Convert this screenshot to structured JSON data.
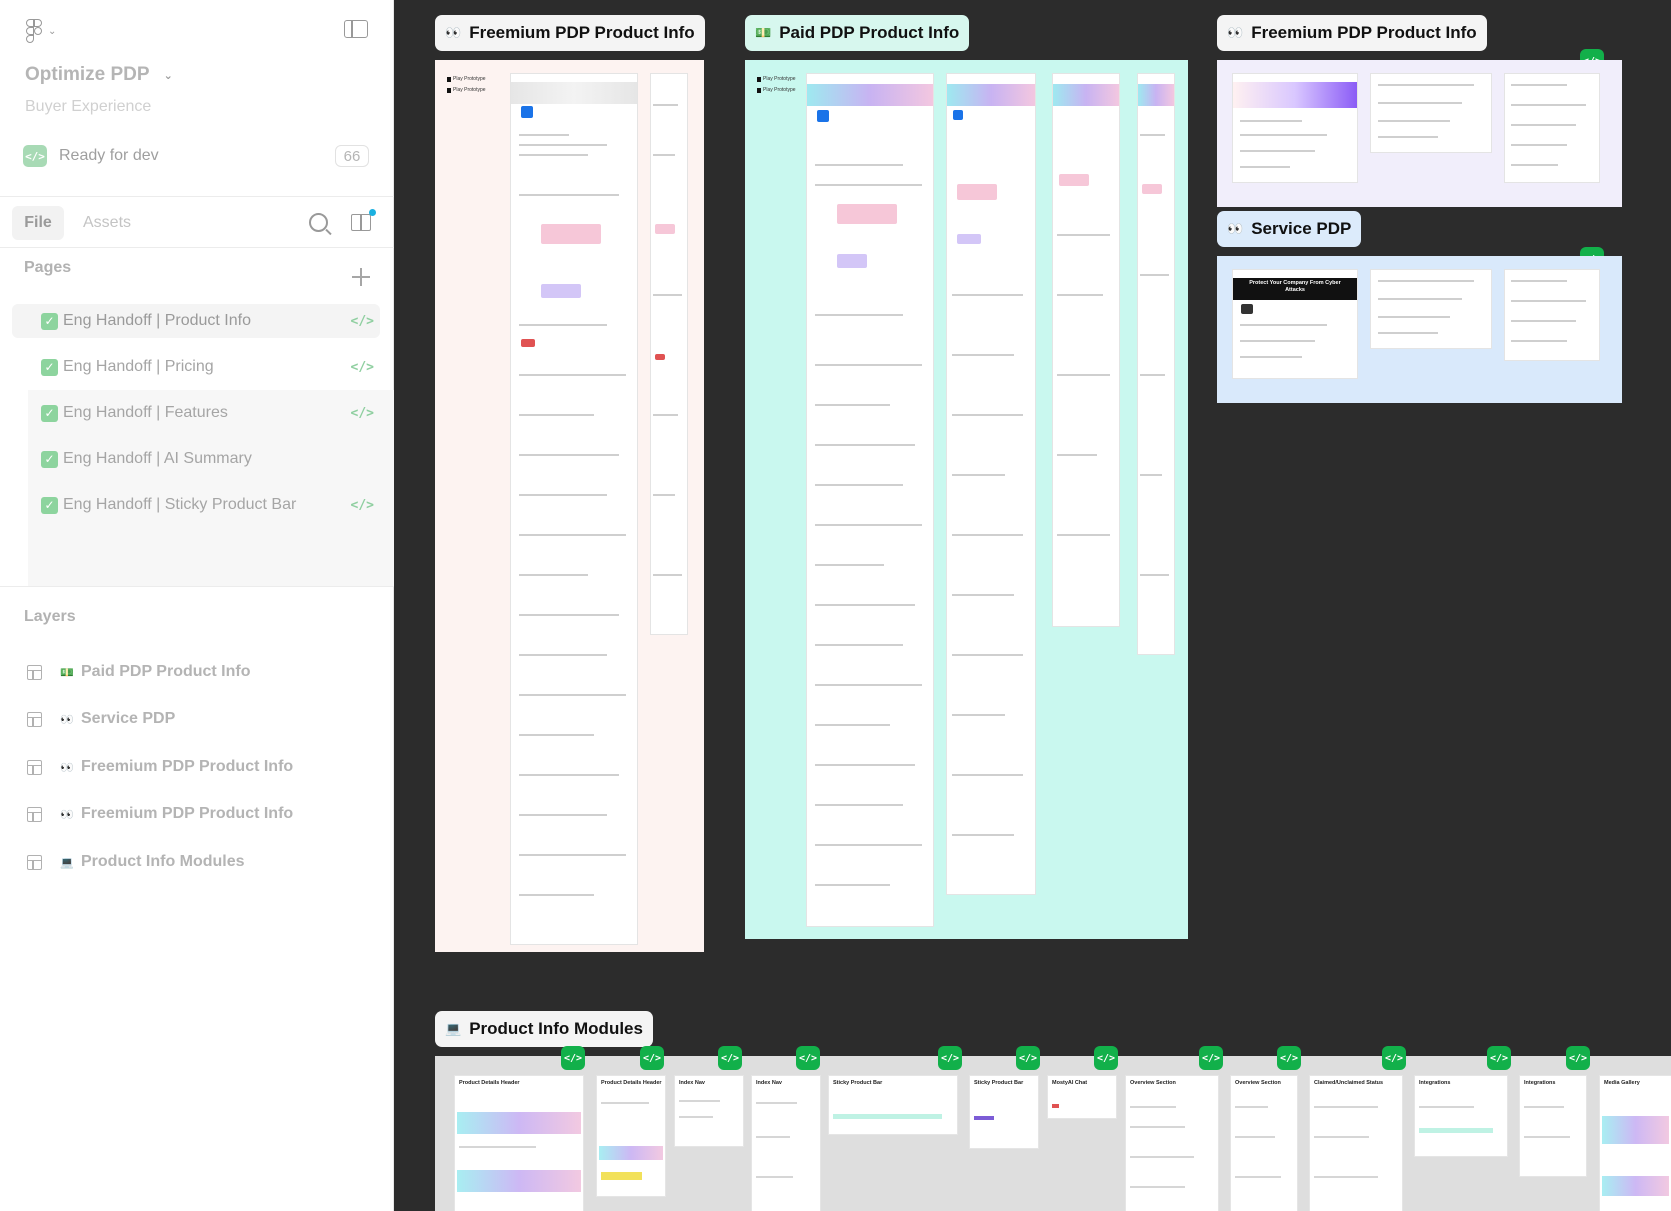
{
  "sidebar": {
    "file_title": "Optimize PDP",
    "file_subtitle": "Buyer Experience",
    "ready_label": "Ready for dev",
    "ready_count": "66",
    "tabs": {
      "file": "File",
      "assets": "Assets"
    },
    "pages_title": "Pages",
    "pages": [
      {
        "label": "Eng Handoff | Product Info",
        "active": true
      },
      {
        "label": "Eng Handoff | Pricing"
      },
      {
        "label": "Eng Handoff | Features"
      },
      {
        "label": "Eng Handoff | AI Summary"
      },
      {
        "label": "Eng Handoff | Sticky Product Bar"
      }
    ],
    "layers_title": "Layers",
    "layers": [
      {
        "emoji": "💵",
        "label": "Paid PDP Product Info"
      },
      {
        "emoji": "👀",
        "label": "Service PDP"
      },
      {
        "emoji": "👀",
        "label": "Freemium PDP Product Info"
      },
      {
        "emoji": "👀",
        "label": "Freemium PDP Product Info"
      },
      {
        "emoji": "💻",
        "label": "Product Info Modules"
      }
    ]
  },
  "canvas": {
    "frames": [
      {
        "emoji": "👀",
        "title": "Freemium PDP Product Info"
      },
      {
        "emoji": "💵",
        "title": "Paid PDP Product Info"
      },
      {
        "emoji": "👀",
        "title": "Freemium PDP Product Info"
      },
      {
        "emoji": "👀",
        "title": "Service PDP"
      },
      {
        "emoji": "💻",
        "title": "Product Info Modules"
      }
    ],
    "prototype_links": [
      "Play Prototype",
      "Play Prototype"
    ],
    "service_hero": "Protect Your Company From Cyber Attacks",
    "modules": [
      "Product Details Header",
      "Product Details Header",
      "Index Nav",
      "Index Nav",
      "Sticky Product Bar",
      "Sticky Product Bar",
      "MostyAI Chat",
      "Overview Section",
      "Overview Section",
      "Claimed/Unclaimed Status",
      "Integrations",
      "Integrations",
      "Media Gallery"
    ],
    "code_glyph": "</>",
    "colors": {
      "canvas_bg": "#2c2c2c",
      "freemium_bg": "#fdf3f1",
      "paid_bg": "#c9f8ef",
      "freemium2_bg": "#f1eefb",
      "service_bg": "#d9e9fb",
      "modules_bg": "#dedede",
      "code_badge": "#12b04a"
    }
  }
}
